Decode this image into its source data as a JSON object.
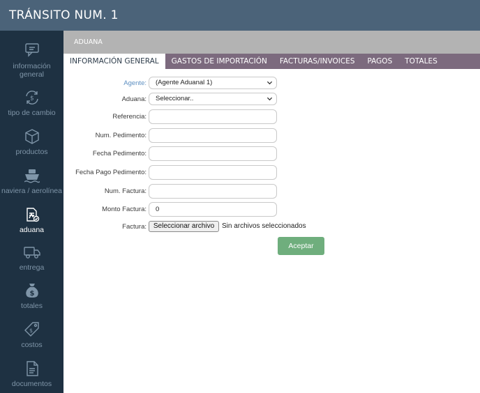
{
  "header": {
    "title": "TRÁNSITO NUM. 1"
  },
  "sidebar": {
    "items": [
      {
        "label": "información general",
        "icon": "chat-bubble-icon",
        "active": false
      },
      {
        "label": "tipo de cambio",
        "icon": "currency-exchange-icon",
        "active": false
      },
      {
        "label": "productos",
        "icon": "box-icon",
        "active": false
      },
      {
        "label": "naviera / aerolínea",
        "icon": "ship-icon",
        "active": false
      },
      {
        "label": "aduana",
        "icon": "customs-document-icon",
        "active": true
      },
      {
        "label": "entrega",
        "icon": "truck-icon",
        "active": false
      },
      {
        "label": "totales",
        "icon": "money-bag-icon",
        "active": false
      },
      {
        "label": "costos",
        "icon": "price-tag-icon",
        "active": false
      },
      {
        "label": "documentos",
        "icon": "document-icon",
        "active": false
      }
    ]
  },
  "section": {
    "title": "ADUANA"
  },
  "tabs": [
    {
      "label": "INFORMACIÓN GENERAL",
      "active": true
    },
    {
      "label": "GASTOS DE IMPORTACIÓN",
      "active": false
    },
    {
      "label": "FACTURAS/INVOICES",
      "active": false
    },
    {
      "label": "PAGOS",
      "active": false
    },
    {
      "label": "TOTALES",
      "active": false
    }
  ],
  "form": {
    "agente": {
      "label": "Agente:",
      "value": "(Agente Aduanal 1)"
    },
    "aduana": {
      "label": "Aduana:",
      "value": "Seleccionar.."
    },
    "referencia": {
      "label": "Referencia:",
      "value": ""
    },
    "num_pedimento": {
      "label": "Num. Pedimento:",
      "value": ""
    },
    "fecha_pedimento": {
      "label": "Fecha Pedimento:",
      "value": ""
    },
    "fecha_pago_pedimento": {
      "label": "Fecha Pago Pedimento:",
      "value": ""
    },
    "num_factura": {
      "label": "Num. Factura:",
      "value": ""
    },
    "monto_factura": {
      "label": "Monto Factura:",
      "value": "0"
    },
    "factura": {
      "label": "Factura:",
      "button_label": "Seleccionar archivo",
      "status": "Sin archivos seleccionados"
    },
    "submit_label": "Aceptar"
  },
  "colors": {
    "topbar": "#4b6379",
    "sidebar": "#1e3142",
    "section_header": "#b3b3b3",
    "tabs_bar": "#7c6a7e",
    "accept_button": "#6fae7d",
    "agente_label": "#5d8fc1"
  }
}
